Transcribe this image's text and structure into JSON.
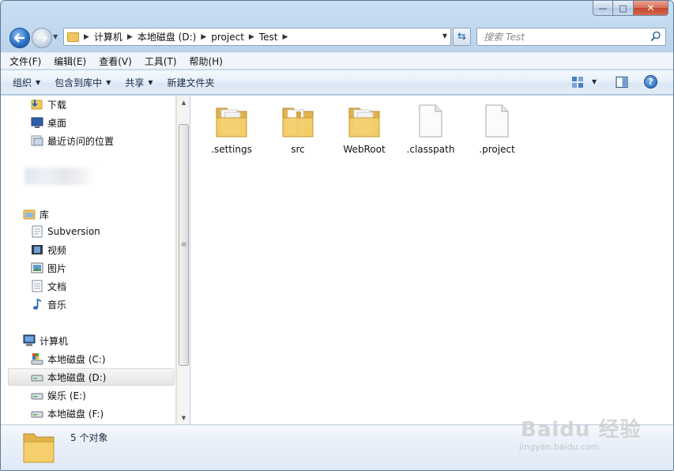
{
  "window": {
    "min_symbol": "—",
    "max_symbol": "□",
    "close_symbol": "✕"
  },
  "address": {
    "crumbs": [
      "计算机",
      "本地磁盘 (D:)",
      "project",
      "Test"
    ]
  },
  "search": {
    "placeholder": "搜索 Test"
  },
  "menu": [
    "文件(F)",
    "编辑(E)",
    "查看(V)",
    "工具(T)",
    "帮助(H)"
  ],
  "commands": [
    {
      "label": "组织",
      "dropdown": true
    },
    {
      "label": "包含到库中",
      "dropdown": true
    },
    {
      "label": "共享",
      "dropdown": true
    },
    {
      "label": "新建文件夹",
      "dropdown": false
    }
  ],
  "nav_pane": {
    "favorites": [
      "下载",
      "桌面",
      "最近访问的位置"
    ],
    "libraries_header": "库",
    "libraries": [
      "Subversion",
      "视频",
      "图片",
      "文档",
      "音乐"
    ],
    "computer_header": "计算机",
    "drives": [
      "本地磁盘 (C:)",
      "本地磁盘 (D:)",
      "娱乐 (E:)",
      "本地磁盘 (F:)"
    ],
    "selected": "本地磁盘 (D:)"
  },
  "files": [
    {
      "name": ".settings",
      "type": "folder-icon"
    },
    {
      "name": "src",
      "type": "folder-icon"
    },
    {
      "name": "WebRoot",
      "type": "folder-icon"
    },
    {
      "name": ".classpath",
      "type": "file-icon"
    },
    {
      "name": ".project",
      "type": "file-icon"
    }
  ],
  "status": {
    "text": "5 个对象"
  },
  "watermark": {
    "brand": "Baidu 经验",
    "url": "jingyan.baidu.com"
  },
  "colors": {
    "frame": "#bcd5ec",
    "folder": "#f0c75e",
    "selection": "#e5e5e5"
  }
}
